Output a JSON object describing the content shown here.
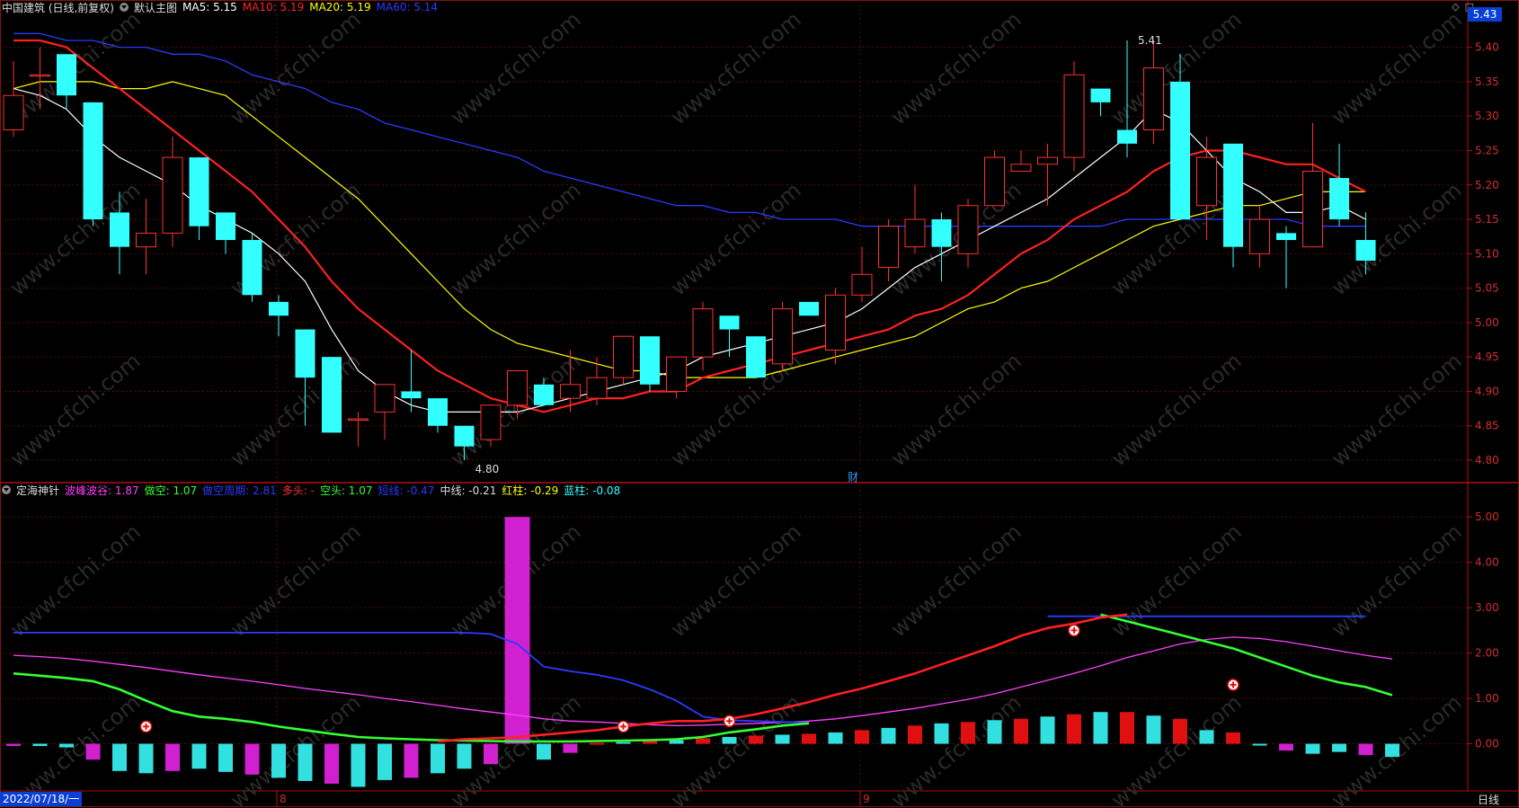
{
  "header": {
    "stock_title": "中国建筑 (日线,前复权)",
    "main_chart_label": "默认主图",
    "ma5": {
      "label": "MA5: 5.15",
      "color": "#ffffff"
    },
    "ma10": {
      "label": "MA10: 5.19",
      "color": "#ff2020"
    },
    "ma20": {
      "label": "MA20: 5.19",
      "color": "#ffff00"
    },
    "ma60": {
      "label": "MA60: 5.14",
      "color": "#2a3cff"
    },
    "current_price": "5.43"
  },
  "indicator": {
    "name": "定海神针",
    "items": [
      {
        "label": "波峰波谷: 1.87",
        "color": "#ff40ff"
      },
      {
        "label": "做空: 1.07",
        "color": "#33ff33"
      },
      {
        "label": "做空周期: 2.81",
        "color": "#2a3cff"
      },
      {
        "label": "多头: -",
        "color": "#ff3030"
      },
      {
        "label": "空头: 1.07",
        "color": "#33ff33"
      },
      {
        "label": "短线: -0.47",
        "color": "#2a3cff"
      },
      {
        "label": "中线: -0.21",
        "color": "#dddddd"
      },
      {
        "label": "红柱: -0.29",
        "color": "#ffff00"
      },
      {
        "label": "蓝柱: -0.08",
        "color": "#33ffff"
      }
    ]
  },
  "price_axis": [
    "5.40",
    "5.35",
    "5.30",
    "5.25",
    "5.20",
    "5.15",
    "5.10",
    "5.05",
    "5.00",
    "4.95",
    "4.90",
    "4.85",
    "4.80"
  ],
  "indicator_axis": [
    "5.00",
    "4.00",
    "3.00",
    "2.00",
    "1.00",
    "0.00"
  ],
  "annotations": {
    "high": "5.41",
    "low": "4.80",
    "finance_marker": "财"
  },
  "time_axis": {
    "date": "2022/07/18/一",
    "month_marks": [
      "8",
      "9"
    ],
    "period": "日线"
  },
  "watermark": "www.cfchi.com",
  "chart_data": {
    "type": "candlestick",
    "ylim": [
      4.77,
      5.44
    ],
    "candles": [
      {
        "o": 5.28,
        "h": 5.38,
        "l": 5.27,
        "c": 5.33
      },
      {
        "o": 5.36,
        "h": 5.4,
        "l": 5.31,
        "c": 5.36
      },
      {
        "o": 5.39,
        "h": 5.39,
        "l": 5.31,
        "c": 5.33
      },
      {
        "o": 5.32,
        "h": 5.32,
        "l": 5.14,
        "c": 5.15
      },
      {
        "o": 5.16,
        "h": 5.19,
        "l": 5.07,
        "c": 5.11
      },
      {
        "o": 5.11,
        "h": 5.18,
        "l": 5.07,
        "c": 5.13
      },
      {
        "o": 5.13,
        "h": 5.27,
        "l": 5.11,
        "c": 5.24
      },
      {
        "o": 5.24,
        "h": 5.24,
        "l": 5.12,
        "c": 5.14
      },
      {
        "o": 5.16,
        "h": 5.16,
        "l": 5.1,
        "c": 5.12
      },
      {
        "o": 5.12,
        "h": 5.13,
        "l": 5.03,
        "c": 5.04
      },
      {
        "o": 5.03,
        "h": 5.04,
        "l": 4.98,
        "c": 5.01
      },
      {
        "o": 4.99,
        "h": 4.99,
        "l": 4.85,
        "c": 4.92
      },
      {
        "o": 4.95,
        "h": 4.95,
        "l": 4.84,
        "c": 4.84
      },
      {
        "o": 4.86,
        "h": 4.87,
        "l": 4.82,
        "c": 4.86
      },
      {
        "o": 4.87,
        "h": 4.91,
        "l": 4.83,
        "c": 4.91
      },
      {
        "o": 4.9,
        "h": 4.96,
        "l": 4.87,
        "c": 4.89
      },
      {
        "o": 4.89,
        "h": 4.89,
        "l": 4.84,
        "c": 4.85
      },
      {
        "o": 4.85,
        "h": 4.85,
        "l": 4.8,
        "c": 4.82
      },
      {
        "o": 4.83,
        "h": 4.88,
        "l": 4.82,
        "c": 4.88
      },
      {
        "o": 4.88,
        "h": 4.93,
        "l": 4.86,
        "c": 4.93
      },
      {
        "o": 4.91,
        "h": 4.92,
        "l": 4.88,
        "c": 4.88
      },
      {
        "o": 4.89,
        "h": 4.96,
        "l": 4.87,
        "c": 4.91
      },
      {
        "o": 4.89,
        "h": 4.95,
        "l": 4.88,
        "c": 4.92
      },
      {
        "o": 4.92,
        "h": 4.98,
        "l": 4.91,
        "c": 4.98
      },
      {
        "o": 4.98,
        "h": 4.98,
        "l": 4.9,
        "c": 4.91
      },
      {
        "o": 4.9,
        "h": 4.95,
        "l": 4.89,
        "c": 4.95
      },
      {
        "o": 4.95,
        "h": 5.03,
        "l": 4.93,
        "c": 5.02
      },
      {
        "o": 5.01,
        "h": 5.01,
        "l": 4.95,
        "c": 4.99
      },
      {
        "o": 4.98,
        "h": 4.98,
        "l": 4.92,
        "c": 4.92
      },
      {
        "o": 4.94,
        "h": 5.03,
        "l": 4.93,
        "c": 5.02
      },
      {
        "o": 5.03,
        "h": 5.03,
        "l": 5.01,
        "c": 5.01
      },
      {
        "o": 4.96,
        "h": 5.05,
        "l": 4.94,
        "c": 5.04
      },
      {
        "o": 5.04,
        "h": 5.11,
        "l": 5.03,
        "c": 5.07
      },
      {
        "o": 5.08,
        "h": 5.15,
        "l": 5.06,
        "c": 5.14
      },
      {
        "o": 5.11,
        "h": 5.2,
        "l": 5.1,
        "c": 5.15
      },
      {
        "o": 5.15,
        "h": 5.16,
        "l": 5.06,
        "c": 5.11
      },
      {
        "o": 5.1,
        "h": 5.18,
        "l": 5.08,
        "c": 5.17
      },
      {
        "o": 5.17,
        "h": 5.25,
        "l": 5.17,
        "c": 5.24
      },
      {
        "o": 5.22,
        "h": 5.25,
        "l": 5.22,
        "c": 5.23
      },
      {
        "o": 5.23,
        "h": 5.26,
        "l": 5.17,
        "c": 5.24
      },
      {
        "o": 5.24,
        "h": 5.38,
        "l": 5.22,
        "c": 5.36
      },
      {
        "o": 5.34,
        "h": 5.34,
        "l": 5.3,
        "c": 5.32
      },
      {
        "o": 5.28,
        "h": 5.41,
        "l": 5.24,
        "c": 5.26
      },
      {
        "o": 5.28,
        "h": 5.41,
        "l": 5.26,
        "c": 5.37
      },
      {
        "o": 5.35,
        "h": 5.39,
        "l": 5.15,
        "c": 5.15
      },
      {
        "o": 5.17,
        "h": 5.27,
        "l": 5.12,
        "c": 5.24
      },
      {
        "o": 5.26,
        "h": 5.26,
        "l": 5.08,
        "c": 5.11
      },
      {
        "o": 5.1,
        "h": 5.17,
        "l": 5.08,
        "c": 5.15
      },
      {
        "o": 5.13,
        "h": 5.14,
        "l": 5.05,
        "c": 5.12
      },
      {
        "o": 5.11,
        "h": 5.29,
        "l": 5.11,
        "c": 5.22
      },
      {
        "o": 5.21,
        "h": 5.26,
        "l": 5.14,
        "c": 5.15
      },
      {
        "o": 5.12,
        "h": 5.16,
        "l": 5.07,
        "c": 5.09
      }
    ],
    "ma5": [
      5.34,
      5.33,
      5.31,
      5.27,
      5.24,
      5.22,
      5.2,
      5.17,
      5.15,
      5.13,
      5.1,
      5.06,
      4.99,
      4.93,
      4.9,
      4.88,
      4.87,
      4.87,
      4.87,
      4.87,
      4.88,
      4.89,
      4.9,
      4.91,
      4.92,
      4.93,
      4.95,
      4.96,
      4.97,
      4.98,
      4.99,
      5.0,
      5.02,
      5.05,
      5.08,
      5.1,
      5.12,
      5.14,
      5.16,
      5.18,
      5.21,
      5.24,
      5.27,
      5.31,
      5.29,
      5.25,
      5.21,
      5.19,
      5.16,
      5.16,
      5.17,
      5.15
    ],
    "ma10": [
      5.41,
      5.41,
      5.4,
      5.37,
      5.34,
      5.31,
      5.28,
      5.25,
      5.22,
      5.19,
      5.15,
      5.11,
      5.06,
      5.02,
      4.99,
      4.96,
      4.93,
      4.91,
      4.89,
      4.88,
      4.87,
      4.88,
      4.89,
      4.89,
      4.9,
      4.9,
      4.92,
      4.93,
      4.94,
      4.95,
      4.96,
      4.97,
      4.98,
      4.99,
      5.01,
      5.02,
      5.04,
      5.07,
      5.1,
      5.12,
      5.15,
      5.17,
      5.19,
      5.22,
      5.24,
      5.25,
      5.25,
      5.24,
      5.23,
      5.23,
      5.21,
      5.19
    ],
    "ma20": [
      5.34,
      5.35,
      5.35,
      5.35,
      5.34,
      5.34,
      5.35,
      5.34,
      5.33,
      5.3,
      5.27,
      5.24,
      5.21,
      5.18,
      5.14,
      5.1,
      5.06,
      5.02,
      4.99,
      4.97,
      4.96,
      4.95,
      4.94,
      4.93,
      4.93,
      4.92,
      4.92,
      4.92,
      4.92,
      4.93,
      4.94,
      4.95,
      4.96,
      4.97,
      4.98,
      5.0,
      5.02,
      5.03,
      5.05,
      5.06,
      5.08,
      5.1,
      5.12,
      5.14,
      5.15,
      5.16,
      5.17,
      5.17,
      5.18,
      5.19,
      5.19,
      5.19
    ],
    "ma60": [
      5.42,
      5.42,
      5.41,
      5.41,
      5.4,
      5.4,
      5.39,
      5.39,
      5.38,
      5.36,
      5.35,
      5.34,
      5.32,
      5.31,
      5.29,
      5.28,
      5.27,
      5.26,
      5.25,
      5.24,
      5.22,
      5.21,
      5.2,
      5.19,
      5.18,
      5.17,
      5.17,
      5.16,
      5.16,
      5.15,
      5.15,
      5.15,
      5.14,
      5.14,
      5.14,
      5.14,
      5.14,
      5.14,
      5.14,
      5.14,
      5.14,
      5.14,
      5.15,
      5.15,
      5.15,
      5.15,
      5.15,
      5.15,
      5.15,
      5.14,
      5.14,
      5.14
    ],
    "indicator": {
      "ylim": [
        -1.0,
        5.4
      ],
      "peak_valley": [
        1.95,
        1.92,
        1.88,
        1.82,
        1.75,
        1.68,
        1.6,
        1.52,
        1.45,
        1.38,
        1.3,
        1.22,
        1.15,
        1.08,
        1.0,
        0.93,
        0.85,
        0.77,
        0.7,
        0.63,
        0.55,
        0.5,
        0.48,
        0.45,
        0.42,
        0.4,
        0.41,
        0.43,
        0.45,
        0.47,
        0.5,
        0.55,
        0.62,
        0.7,
        0.78,
        0.88,
        0.98,
        1.1,
        1.25,
        1.4,
        1.55,
        1.72,
        1.9,
        2.05,
        2.2,
        2.3,
        2.35,
        2.32,
        2.25,
        2.15,
        2.05,
        1.95,
        1.87
      ],
      "short_cycle": [
        2.45,
        2.45,
        2.45,
        2.45,
        2.45,
        2.45,
        2.45,
        2.45,
        2.45,
        2.45,
        2.45,
        2.45,
        2.45,
        2.45,
        2.45,
        2.45,
        2.45,
        2.45,
        2.42,
        2.2,
        1.7,
        1.6,
        1.52,
        1.4,
        1.2,
        0.95,
        0.6,
        0.52,
        0.5,
        0.48,
        0.47,
        null,
        null,
        null,
        null,
        null,
        null,
        null,
        null,
        2.81,
        2.81,
        2.81,
        2.81,
        2.81,
        2.81,
        2.81,
        2.81,
        2.81,
        2.81,
        2.81,
        2.81,
        2.81
      ],
      "green_line": [
        1.55,
        1.5,
        1.45,
        1.38,
        1.2,
        0.95,
        0.72,
        0.6,
        0.55,
        0.48,
        0.38,
        0.3,
        0.22,
        0.15,
        0.12,
        0.1,
        0.08,
        0.07,
        0.06,
        0.05,
        0.05,
        0.05,
        0.06,
        0.07,
        0.08,
        0.1,
        0.15,
        0.25,
        0.32,
        0.4,
        0.45,
        null,
        null,
        null,
        null,
        null,
        null,
        null,
        null,
        null,
        null,
        2.85,
        2.7,
        2.55,
        2.4,
        2.25,
        2.1,
        1.9,
        1.7,
        1.5,
        1.35,
        1.25,
        1.07
      ],
      "red_line": [
        null,
        null,
        null,
        null,
        null,
        null,
        null,
        null,
        null,
        null,
        null,
        null,
        null,
        null,
        null,
        null,
        0.05,
        0.1,
        0.12,
        0.15,
        0.2,
        0.25,
        0.3,
        0.38,
        0.45,
        0.5,
        0.5,
        0.55,
        0.65,
        0.78,
        0.92,
        1.08,
        1.22,
        1.38,
        1.55,
        1.75,
        1.95,
        2.15,
        2.38,
        2.55,
        2.65,
        2.78,
        2.85
      ],
      "bars": [
        -0.05,
        -0.05,
        -0.08,
        -0.35,
        -0.6,
        -0.65,
        -0.6,
        -0.55,
        -0.62,
        -0.68,
        -0.75,
        -0.82,
        -0.88,
        -0.95,
        -0.8,
        -0.75,
        -0.65,
        -0.55,
        -0.45,
        5.0,
        -0.35,
        -0.2,
        0.02,
        0.04,
        0.06,
        0.08,
        0.12,
        0.15,
        0.18,
        0.2,
        0.22,
        0.25,
        0.3,
        0.35,
        0.4,
        0.45,
        0.48,
        0.52,
        0.55,
        0.6,
        0.65,
        0.7,
        0.7,
        0.62,
        0.55,
        0.3,
        0.25,
        -0.02,
        -0.15,
        -0.22,
        -0.18,
        -0.25,
        -0.29
      ]
    }
  }
}
